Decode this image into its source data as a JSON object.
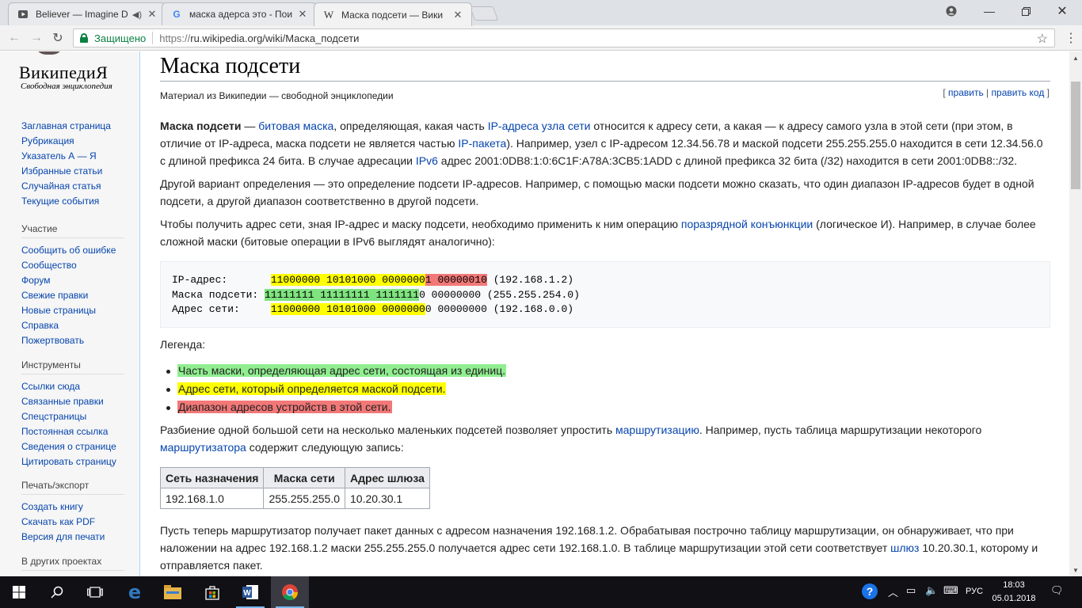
{
  "browser": {
    "tabs": [
      {
        "title": "Believer — Imagine D",
        "icon": "youtube-play-icon"
      },
      {
        "title": "маска адерса это - Поис",
        "icon": "google-g-icon"
      },
      {
        "title": "Маска подсети — Вики",
        "icon": "wikipedia-w-icon"
      }
    ],
    "secure_label": "Защищено",
    "url_scheme": "https://",
    "url_rest": "ru.wikipedia.org/wiki/Маска_подсети",
    "colors": {
      "secure": "#0b8043",
      "link": "#0645ad"
    }
  },
  "wiki": {
    "logo_wordmark": "ВикипедиЯ",
    "logo_tagline": "Свободная энциклопедия",
    "nav_main": [
      "Заглавная страница",
      "Рубрикация",
      "Указатель А — Я",
      "Избранные статьи",
      "Случайная статья",
      "Текущие события"
    ],
    "participation": {
      "heading": "Участие",
      "items": [
        "Сообщить об ошибке",
        "Сообщество",
        "Форум",
        "Свежие правки",
        "Новые страницы",
        "Справка",
        "Пожертвовать"
      ]
    },
    "tools": {
      "heading": "Инструменты",
      "items": [
        "Ссылки сюда",
        "Связанные правки",
        "Спецстраницы",
        "Постоянная ссылка",
        "Сведения о странице",
        "Цитировать страницу"
      ]
    },
    "print": {
      "heading": "Печать/экспорт",
      "items": [
        "Создать книгу",
        "Скачать как PDF",
        "Версия для печати"
      ]
    },
    "other_projects_heading": "В других проектах"
  },
  "article": {
    "title": "Маска подсети",
    "site_sub": "Материал из Википедии — свободной энциклопедии",
    "edit_open": "[ ",
    "edit_link": "править",
    "edit_sep": " | ",
    "edit_code_link": "править код",
    "edit_close": " ]",
    "p1": {
      "bold": "Маска подсети",
      "t1": " — ",
      "l1": "битовая маска",
      "t2": ", определяющая, какая часть ",
      "l2": "IP-адреса",
      "t3": " ",
      "l3": "узла сети",
      "t4": " относится к адресу сети, а какая — к адресу самого узла в этой сети (при этом, в отличие от IP-адреса, маска подсети не является частью ",
      "l4": "IP-пакета",
      "t5": "). Например, узел с IP-адресом 12.34.56.78 и маской подсети 255.255.255.0 находится в сети 12.34.56.0 с длиной префикса 24 бита. В случае адресации ",
      "l5": "IPv6",
      "t6": " адрес 2001:0DB8:1:0:6C1F:A78A:3CB5:1ADD с длиной префикса 32 бита (/32) находится в сети 2001:0DB8::/32."
    },
    "p2": "Другой вариант определения — это определение подсети IP-адресов. Например, с помощью маски подсети можно сказать, что один диапазон IP-адресов будет в одной подсети, а другой диапазон соответственно в другой подсети.",
    "p3": {
      "t1": "Чтобы получить адрес сети, зная IP-адрес и маску подсети, необходимо применить к ним операцию ",
      "l1": "поразрядной конъюнкции",
      "t2": " (логическое И). Например, в случае более сложной маски (битовые операции в IPv6 выглядят аналогично):"
    },
    "code": {
      "ip": {
        "label": "IP-адрес:       ",
        "net": "11000000 10101000 0000000",
        "host": "1 00000010",
        "rest": " (192.168.1.2)"
      },
      "mask": {
        "label": "Маска подсети: ",
        "net": "11111111 11111111 1111111",
        "rest": "0 00000000 (255.255.254.0)"
      },
      "addr": {
        "label": "Адрес сети:     ",
        "net": "11000000 10101000 0000000",
        "rest": "0 00000000 (192.168.0.0)"
      }
    },
    "legend_label": "Легенда:",
    "legend": [
      "Часть маски, определяющая адрес сети, состоящая из единиц.",
      "Адрес сети, который определяется маской подсети.",
      "Диапазон адресов устройств в этой сети."
    ],
    "highlight_colors": {
      "mask": "#7fe37f",
      "network": "#ffff00",
      "host": "#f27878"
    },
    "p4": {
      "t1": "Разбиение одной большой сети на несколько маленьких подсетей позволяет упростить ",
      "l1": "маршрутизацию",
      "t2": ". Например, пусть таблица маршрутизации некоторого ",
      "l2": "маршрутизатора",
      "t3": " содержит следующую запись:"
    },
    "table": {
      "headers": [
        "Сеть назначения",
        "Маска сети",
        "Адрес шлюза"
      ],
      "row": [
        "192.168.1.0",
        "255.255.255.0",
        "10.20.30.1"
      ]
    },
    "p5": {
      "t1": "Пусть теперь маршрутизатор получает пакет данных с адресом назначения 192.168.1.2. Обрабатывая построчно таблицу маршрутизации, он обнаруживает, что при наложении на адрес 192.168.1.2 маски 255.255.255.0 получается адрес сети 192.168.1.0. В таблице маршрутизации этой сети соответствует ",
      "l1": "шлюз",
      "t2": " 10.20.30.1, которому и отправляется пакет."
    }
  },
  "taskbar": {
    "language": "РУС",
    "time": "18:03",
    "date": "05.01.2018"
  }
}
